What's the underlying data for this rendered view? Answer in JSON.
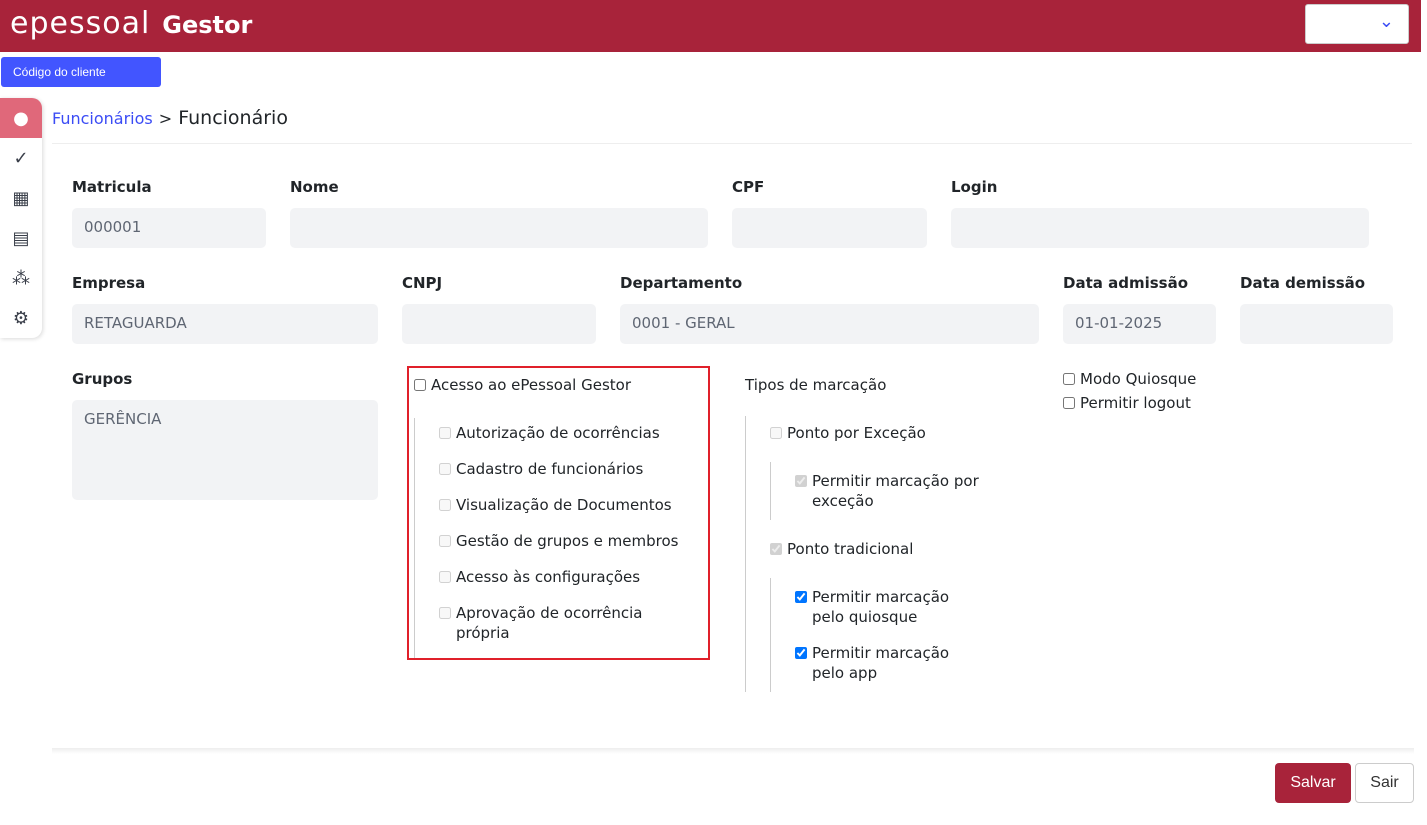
{
  "header": {
    "brand": "epessoal",
    "product": "Gestor",
    "select_value": ""
  },
  "client_button": "Código do cliente",
  "sidebar": [
    {
      "name": "user-icon",
      "glyph": "👤"
    },
    {
      "name": "check-icon",
      "glyph": "✓"
    },
    {
      "name": "grid-edit-icon",
      "glyph": "▦"
    },
    {
      "name": "document-icon",
      "glyph": "▤"
    },
    {
      "name": "group-icon",
      "glyph": "👥"
    },
    {
      "name": "gear-icon",
      "glyph": "⚙"
    }
  ],
  "breadcrumb": {
    "parent": "Funcionários",
    "sep": ">",
    "current": "Funcionário"
  },
  "fields": {
    "matricula": {
      "label": "Matricula",
      "value": "000001"
    },
    "nome": {
      "label": "Nome",
      "value": ""
    },
    "cpf": {
      "label": "CPF",
      "value": ""
    },
    "login": {
      "label": "Login",
      "value": ""
    },
    "empresa": {
      "label": "Empresa",
      "value": "RETAGUARDA"
    },
    "cnpj": {
      "label": "CNPJ",
      "value": ""
    },
    "departamento": {
      "label": "Departamento",
      "value": "0001 - GERAL"
    },
    "admissao": {
      "label": "Data admissão",
      "value": "01-01-2025"
    },
    "demissao": {
      "label": "Data demissão",
      "value": ""
    },
    "grupos": {
      "label": "Grupos",
      "value": "GERÊNCIA"
    }
  },
  "gestor": {
    "label": "Acesso ao ePessoal Gestor",
    "checked": false,
    "items": [
      {
        "label": "Autorização de ocorrências"
      },
      {
        "label": "Cadastro de funcionários"
      },
      {
        "label": "Visualização de Documentos"
      },
      {
        "label": "Gestão de grupos e membros"
      },
      {
        "label": "Acesso às configurações"
      },
      {
        "label": "Aprovação de ocorrência própria"
      }
    ]
  },
  "marcacao": {
    "title": "Tipos de marcação",
    "excecao": "Ponto por Exceção",
    "excecao_sub": "Permitir marcação por exceção",
    "tradicional": "Ponto tradicional",
    "quiosque": "Permitir marcação pelo quiosque",
    "app": "Permitir marcação pelo app"
  },
  "options": {
    "quiosque": "Modo Quiosque",
    "logout": "Permitir logout"
  },
  "buttons": {
    "save": "Salvar",
    "exit": "Sair"
  }
}
